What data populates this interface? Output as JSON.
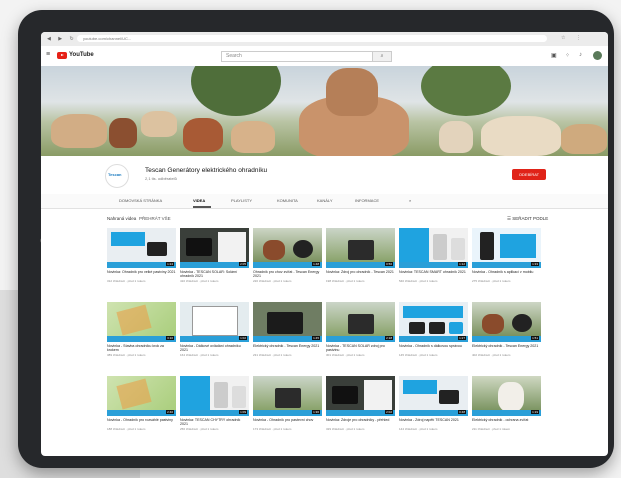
{
  "browser": {
    "url": "youtube.com/channel/UC..."
  },
  "youtube": {
    "logo_text": "YouTube",
    "search_placeholder": "Search"
  },
  "channel": {
    "name": "Tescan Generátory elektrického ohradníku",
    "subscribers": "2,1 tis. odběratelů",
    "avatar_text": "Tescan",
    "subscribe_label": "ODEBÍRAT"
  },
  "tabs": [
    {
      "label": "DOMOVSKÁ STRÁNKA"
    },
    {
      "label": "VIDEA"
    },
    {
      "label": "PLAYLISTY"
    },
    {
      "label": "KOMUNITA"
    },
    {
      "label": "KANÁLY"
    },
    {
      "label": "INFORMACE"
    }
  ],
  "content": {
    "section_title": "Nahraná videa",
    "play_all": "PŘEHRÁT VŠE",
    "sort_label": "SEŘADIT PODLE"
  },
  "colors": {
    "brand_red": "#e02318",
    "accent_blue": "#1fa3e0",
    "tablet_frame": "#26282b"
  },
  "videos": [
    {
      "title": "Novinka: Ohradník pro velké pastviny 2021",
      "meta": "312 zhlédnutí · před 1 rokem",
      "duration": "1:24",
      "style": "blue"
    },
    {
      "title": "Novinka - TESCAN SOLAR: Solární ohradník 2021",
      "meta": "410 zhlédnutí · před 1 rokem",
      "duration": "2:05",
      "style": "device"
    },
    {
      "title": "Ohradník pro chov zvířat - Tescan Energy 2021",
      "meta": "220 zhlédnutí · před 1 rokem",
      "duration": "1:48",
      "style": "cow"
    },
    {
      "title": "Novinka: Zdroj pro ohradník - Tescan 2021",
      "meta": "198 zhlédnutí · před 1 rokem",
      "duration": "0:56",
      "style": "field"
    },
    {
      "title": "Novinka: TESCAN SMART ohradník 2021",
      "meta": "540 zhlédnutí · před 1 rokem",
      "duration": "1:12",
      "style": "smart"
    },
    {
      "title": "Novinka - Ohradník s aplikací v mobilu",
      "meta": "275 zhlédnutí · před 1 rokem",
      "duration": "1:33",
      "style": "phone"
    },
    {
      "title": "Novinka - Stavba ohradníku krok za krokem",
      "meta": "389 zhlédnutí · před 1 rokem",
      "duration": "3:10",
      "style": "map"
    },
    {
      "title": "Novinka - Dálkové ovládání ohradníku 2021",
      "meta": "164 zhlédnutí · před 1 rokem",
      "duration": "1:02",
      "style": "monitor"
    },
    {
      "title": "Elektrický ohradník - Tescan Energy 2021",
      "meta": "231 zhlédnutí · před 1 rokem",
      "duration": "1:45",
      "style": "device2"
    },
    {
      "title": "Novinka - TESCAN SOLAR zdroj pro pastvinu",
      "meta": "301 zhlédnutí · před 1 rokem",
      "duration": "2:18",
      "style": "field"
    },
    {
      "title": "Novinka - Ohradník s dálkovou správou",
      "meta": "145 zhlédnutí · před 1 rokem",
      "duration": "1:27",
      "style": "devices"
    },
    {
      "title": "Elektrický ohradník - Tescan Energy 2021",
      "meta": "402 zhlédnutí · před 1 rokem",
      "duration": "1:51",
      "style": "cow"
    },
    {
      "title": "Novinka - Ohradník pro rozsáhlé pastviny",
      "meta": "188 zhlédnutí · před 1 rokem",
      "duration": "2:40",
      "style": "map"
    },
    {
      "title": "Novinka: TESCAN CHYTRÝ ohradník 2021",
      "meta": "256 zhlédnutí · před 1 rokem",
      "duration": "1:09",
      "style": "smart"
    },
    {
      "title": "Novinka - Ohradník pro pastevní chov",
      "meta": "173 zhlédnutí · před 1 rokem",
      "duration": "1:36",
      "style": "field"
    },
    {
      "title": "Novinka: Zdroje pro ohradníky - přehled",
      "meta": "329 zhlédnutí · před 1 rokem",
      "duration": "2:02",
      "style": "device"
    },
    {
      "title": "Novinka - Zdroj napětí TESCAN 2021",
      "meta": "144 zhlédnutí · před 1 rokem",
      "duration": "0:48",
      "style": "blue"
    },
    {
      "title": "Elektrický ohradník - ochrana zvířat",
      "meta": "211 zhlédnutí · před 1 rokem",
      "duration": "1:19",
      "style": "dog"
    }
  ]
}
